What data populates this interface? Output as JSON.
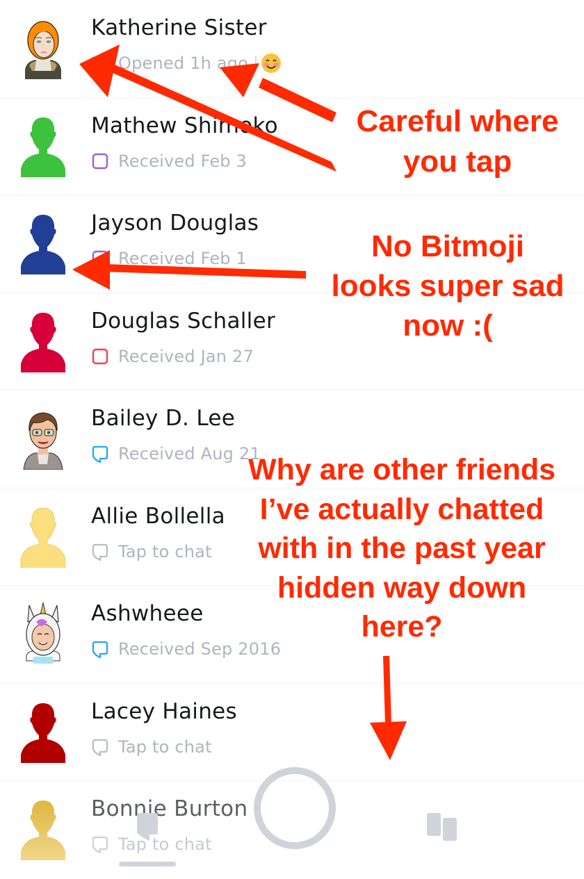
{
  "friends": [
    {
      "name": "Katherine Sister",
      "status_icon": "sent-arrow-icon",
      "status_color": "#2ea7f2",
      "status_text": "Opened 1h ago",
      "friend_emoji": "blushing-smile-emoji",
      "avatar_type": "bitmoji",
      "avatar_desc": "orange-haired bitmoji"
    },
    {
      "name": "Mathew Shimoko",
      "status_icon": "square-outline-icon",
      "status_color": "#a05dd6",
      "status_text": "Received Feb 3",
      "avatar_type": "silhouette",
      "avatar_color": "#3cc23c"
    },
    {
      "name": "Jayson Douglas",
      "status_icon": "square-outline-icon",
      "status_color": "#a05dd6",
      "status_text": "Received Feb 1",
      "avatar_type": "silhouette",
      "avatar_color": "#213f94"
    },
    {
      "name": "Douglas Schaller",
      "status_icon": "square-outline-icon",
      "status_color": "#f23c57",
      "status_text": "Received Jan 27",
      "avatar_type": "silhouette",
      "avatar_color": "#d6003a"
    },
    {
      "name": "Bailey D. Lee",
      "status_icon": "chat-bubble-icon",
      "status_color": "#1fa7f2",
      "status_text": "Received Aug 21",
      "avatar_type": "bitmoji",
      "avatar_desc": "brown-haired bitmoji with glasses"
    },
    {
      "name": "Allie Bollella",
      "status_icon": "chat-bubble-icon",
      "status_color": "#b8bec5",
      "status_text": "Tap to chat",
      "avatar_type": "silhouette",
      "avatar_color": "#fbdf7e"
    },
    {
      "name": "Ashwheee",
      "status_icon": "chat-bubble-icon",
      "status_color": "#1fa7f2",
      "status_text": "Received Sep 2016",
      "avatar_type": "bitmoji",
      "avatar_desc": "unicorn hood bitmoji"
    },
    {
      "name": "Lacey Haines",
      "status_icon": "chat-bubble-icon",
      "status_color": "#b8bec5",
      "status_text": "Tap to chat",
      "avatar_type": "silhouette",
      "avatar_color": "#b20000"
    },
    {
      "name": "Bonnie Burton",
      "status_icon": "chat-bubble-icon",
      "status_color": "#b8bec5",
      "status_text": "Tap to chat",
      "avatar_type": "silhouette",
      "avatar_color": "#e3bd4c"
    }
  ],
  "bottom_nav": {
    "chat_icon": "chat-icon",
    "capture_icon": "capture-button",
    "discover_icon": "discover-icon",
    "icon_color": "#cfd4da"
  },
  "annotations": {
    "color": "#ff2a00",
    "note_1": [
      "Careful where",
      "you tap"
    ],
    "note_2": [
      "No Bitmoji",
      "looks super sad",
      "now :("
    ],
    "note_3": [
      "Why are other friends",
      "I’ve actually chatted",
      "with in the past year",
      "hidden way down",
      "here?"
    ]
  }
}
